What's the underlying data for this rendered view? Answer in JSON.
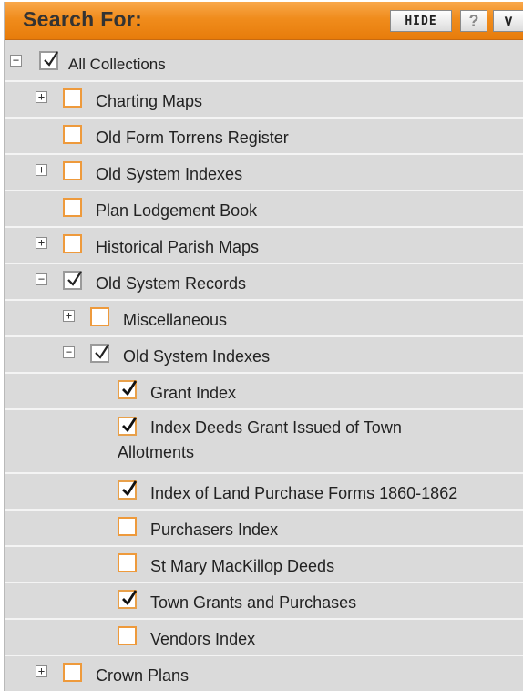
{
  "header": {
    "title": "Search For:",
    "hide_label": "HIDE",
    "help_label": "?",
    "collapse_label": "∨"
  },
  "tree": [
    {
      "label": "All Collections",
      "expander": "minus",
      "checked": true
    },
    {
      "label": "Charting Maps",
      "expander": "plus",
      "checked": false
    },
    {
      "label": "Old Form Torrens Register",
      "expander": "none",
      "checked": false
    },
    {
      "label": "Old System Indexes",
      "expander": "plus",
      "checked": false
    },
    {
      "label": "Plan Lodgement Book",
      "expander": "none",
      "checked": false
    },
    {
      "label": "Historical Parish Maps",
      "expander": "plus",
      "checked": false
    },
    {
      "label": "Old System Records",
      "expander": "minus",
      "checked": true
    },
    {
      "label": "Miscellaneous",
      "expander": "plus",
      "checked": false
    },
    {
      "label": "Old System Indexes",
      "expander": "minus",
      "checked": true
    },
    {
      "label": "Grant Index",
      "expander": "none",
      "checked": true
    },
    {
      "label": "Index Deeds Grant Issued of Town Allotments",
      "expander": "none",
      "checked": true
    },
    {
      "label": "Index of Land Purchase Forms 1860-1862",
      "expander": "none",
      "checked": true
    },
    {
      "label": "Purchasers Index",
      "expander": "none",
      "checked": false
    },
    {
      "label": "St Mary MacKillop Deeds",
      "expander": "none",
      "checked": false
    },
    {
      "label": "Town Grants and Purchases",
      "expander": "none",
      "checked": true
    },
    {
      "label": "Vendors Index",
      "expander": "none",
      "checked": false
    },
    {
      "label": "Crown Plans",
      "expander": "plus",
      "checked": false
    }
  ]
}
